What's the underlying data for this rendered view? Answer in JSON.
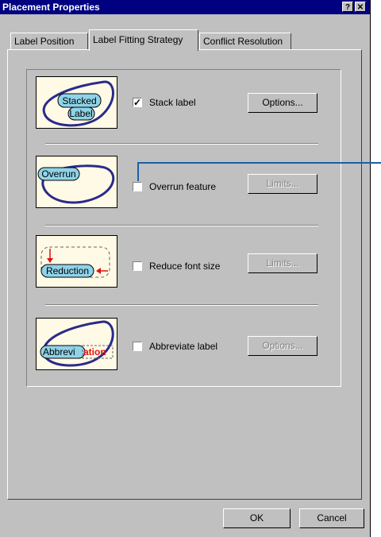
{
  "window": {
    "title": "Placement Properties",
    "help_button": "?",
    "close_button": "✕"
  },
  "tabs": [
    {
      "label": "Label Position",
      "active": false
    },
    {
      "label": "Label Fitting Strategy",
      "active": true
    },
    {
      "label": "Conflict Resolution",
      "active": false
    }
  ],
  "strategies": [
    {
      "image_text": [
        "Stacked",
        "Label"
      ],
      "checkbox_label": "Stack label",
      "checked": true,
      "button": "Options...",
      "button_enabled": true
    },
    {
      "image_text": [
        "Overrun"
      ],
      "checkbox_label": "Overrun feature",
      "checked": false,
      "button": "Limits...",
      "button_enabled": false
    },
    {
      "image_text": [
        "Reduction"
      ],
      "checkbox_label": "Reduce font size",
      "checked": false,
      "button": "Limits...",
      "button_enabled": false
    },
    {
      "image_text": [
        "Abbrevi",
        "ation"
      ],
      "checkbox_label": "Abbreviate label",
      "checked": false,
      "button": "Options...",
      "button_enabled": false
    }
  ],
  "footer": {
    "ok": "OK",
    "cancel": "Cancel"
  },
  "colors": {
    "titlebar": "#000080",
    "dialog": "#c0c0c0",
    "thumb_bg": "#fffae6",
    "ellipse": "#2a2a8a",
    "label_fill": "#8fd3e8",
    "arrow": "#e01010",
    "callout": "#1c5fa8"
  }
}
